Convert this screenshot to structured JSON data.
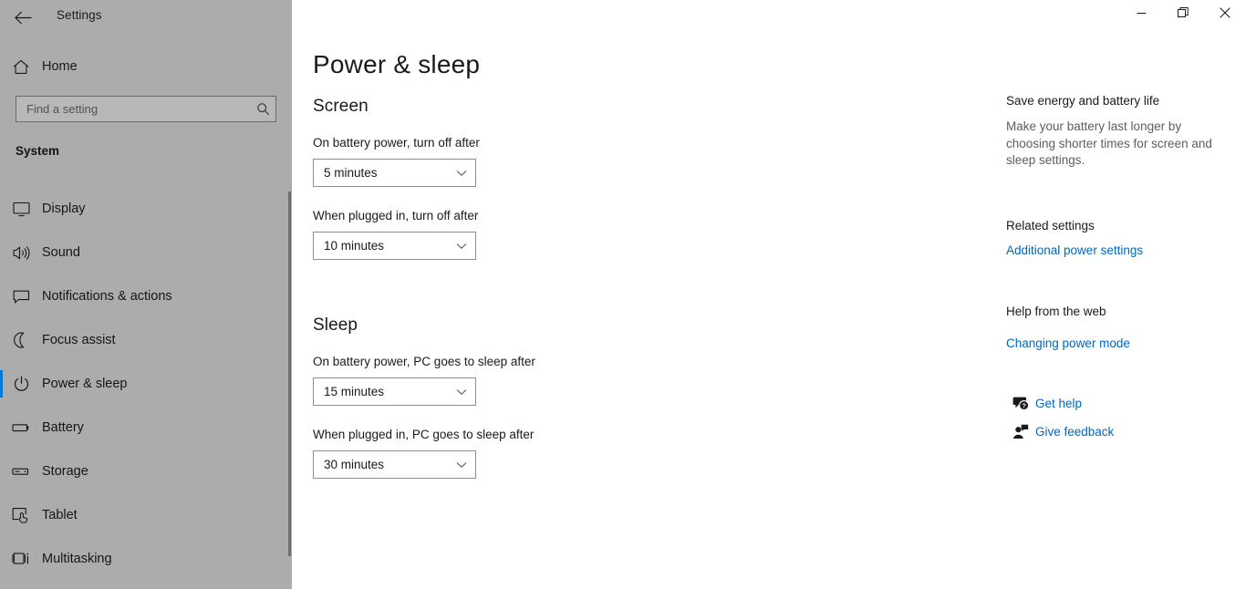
{
  "window": {
    "app_title": "Settings",
    "back_icon": "back-arrow-icon",
    "controls": {
      "minimize_label": "Minimize",
      "restore_label": "Restore",
      "close_label": "Close"
    }
  },
  "sidebar": {
    "home": {
      "label": "Home",
      "icon": "home-icon"
    },
    "search": {
      "value": "",
      "placeholder": "Find a setting",
      "icon": "search-icon"
    },
    "group_title": "System",
    "accent_color": "#0078d7",
    "background_color": "#acacac",
    "items": [
      {
        "label": "Display",
        "icon": "monitor-icon",
        "selected": false
      },
      {
        "label": "Sound",
        "icon": "speaker-icon",
        "selected": false
      },
      {
        "label": "Notifications & actions",
        "icon": "chat-bubble-icon",
        "selected": false
      },
      {
        "label": "Focus assist",
        "icon": "moon-icon",
        "selected": false
      },
      {
        "label": "Power & sleep",
        "icon": "power-icon",
        "selected": true
      },
      {
        "label": "Battery",
        "icon": "battery-icon",
        "selected": false
      },
      {
        "label": "Storage",
        "icon": "drive-icon",
        "selected": false
      },
      {
        "label": "Tablet",
        "icon": "tablet-hand-icon",
        "selected": false
      },
      {
        "label": "Multitasking",
        "icon": "multitasking-icon",
        "selected": false
      }
    ]
  },
  "main": {
    "page_title": "Power & sleep",
    "sections": [
      {
        "title": "Screen",
        "fields": [
          {
            "label": "On battery power, turn off after",
            "value": "5 minutes"
          },
          {
            "label": "When plugged in, turn off after",
            "value": "10 minutes"
          }
        ]
      },
      {
        "title": "Sleep",
        "fields": [
          {
            "label": "On battery power, PC goes to sleep after",
            "value": "15 minutes"
          },
          {
            "label": "When plugged in, PC goes to sleep after",
            "value": "30 minutes"
          }
        ]
      }
    ]
  },
  "right_pane": {
    "tip_heading": "Save energy and battery life",
    "tip_body": "Make your battery last longer by choosing shorter times for screen and sleep settings.",
    "related_heading": "Related settings",
    "related_link": "Additional power settings",
    "help_heading": "Help from the web",
    "help_link": "Changing power mode",
    "get_help": {
      "label": "Get help",
      "icon": "help-bubble-icon"
    },
    "give_feedback": {
      "label": "Give feedback",
      "icon": "feedback-person-icon"
    },
    "link_color": "#0067c0"
  }
}
